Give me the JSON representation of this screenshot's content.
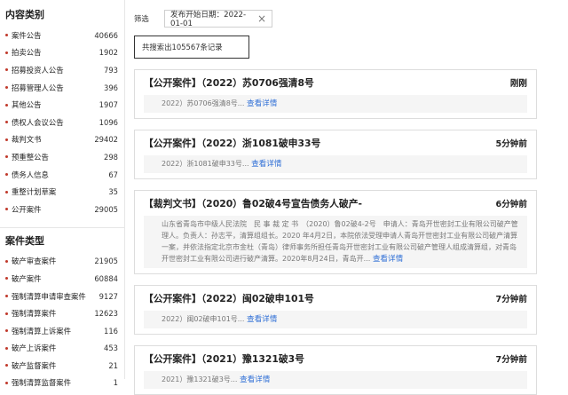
{
  "content_types": {
    "title": "内容类别",
    "items": [
      {
        "label": "案件公告",
        "count": "40666"
      },
      {
        "label": "拍卖公告",
        "count": "1902"
      },
      {
        "label": "招募投资人公告",
        "count": "793"
      },
      {
        "label": "招募管理人公告",
        "count": "396"
      },
      {
        "label": "其他公告",
        "count": "1907"
      },
      {
        "label": "债权人会议公告",
        "count": "1096"
      },
      {
        "label": "裁判文书",
        "count": "29402"
      },
      {
        "label": "预重整公告",
        "count": "298"
      },
      {
        "label": "债务人信息",
        "count": "67"
      },
      {
        "label": "重整计划草案",
        "count": "35"
      },
      {
        "label": "公开案件",
        "count": "29005"
      }
    ]
  },
  "case_types": {
    "title": "案件类型",
    "items": [
      {
        "label": "破产审查案件",
        "count": "21905"
      },
      {
        "label": "破产案件",
        "count": "60884"
      },
      {
        "label": "强制清算申请审查案件",
        "count": "9127"
      },
      {
        "label": "强制清算案件",
        "count": "12623"
      },
      {
        "label": "强制清算上诉案件",
        "count": "116"
      },
      {
        "label": "破产上诉案件",
        "count": "453"
      },
      {
        "label": "破产监督案件",
        "count": "21"
      },
      {
        "label": "强制清算监督案件",
        "count": "1"
      }
    ]
  },
  "filter": {
    "label": "筛选",
    "chip": "发布开始日期：2022-01-01",
    "close": "×"
  },
  "total_text": "共搜索出105567条记录",
  "more_label": "查看详情",
  "results": [
    {
      "title": "【公开案件】（2022）苏0706强清8号",
      "time": "刚刚",
      "snippet": "2022）苏0706强清8号..."
    },
    {
      "title": "【公开案件】（2022）浙1081破申33号",
      "time": "5分钟前",
      "snippet": "2022）浙1081破申33号..."
    },
    {
      "title": "【裁判文书】（2020）鲁02破4号宣告债务人破产-",
      "time": "6分钟前",
      "snippet": "山东省青岛市中级人民法院　民 事 裁 定 书　（2020）鲁02破4-2号　申请人：青岛开世密封工业有限公司破产管理人。负责人：孙志平，清算组组长。2020 年4月2日，本院依法受理申请人青岛开世密封工业有限公司破产清算一案，并依法指定北京市金杜（青岛）律师事务所担任青岛开世密封工业有限公司破产管理人组成清算组，对青岛开世密封工业有限公司进行破产清算。2020年8月24日，青岛开..."
    },
    {
      "title": "【公开案件】（2022）闽02破申101号",
      "time": "7分钟前",
      "snippet": "2022）闽02破申101号..."
    },
    {
      "title": "【公开案件】（2021）豫1321破3号",
      "time": "7分钟前",
      "snippet": "2021）豫1321破3号..."
    }
  ]
}
